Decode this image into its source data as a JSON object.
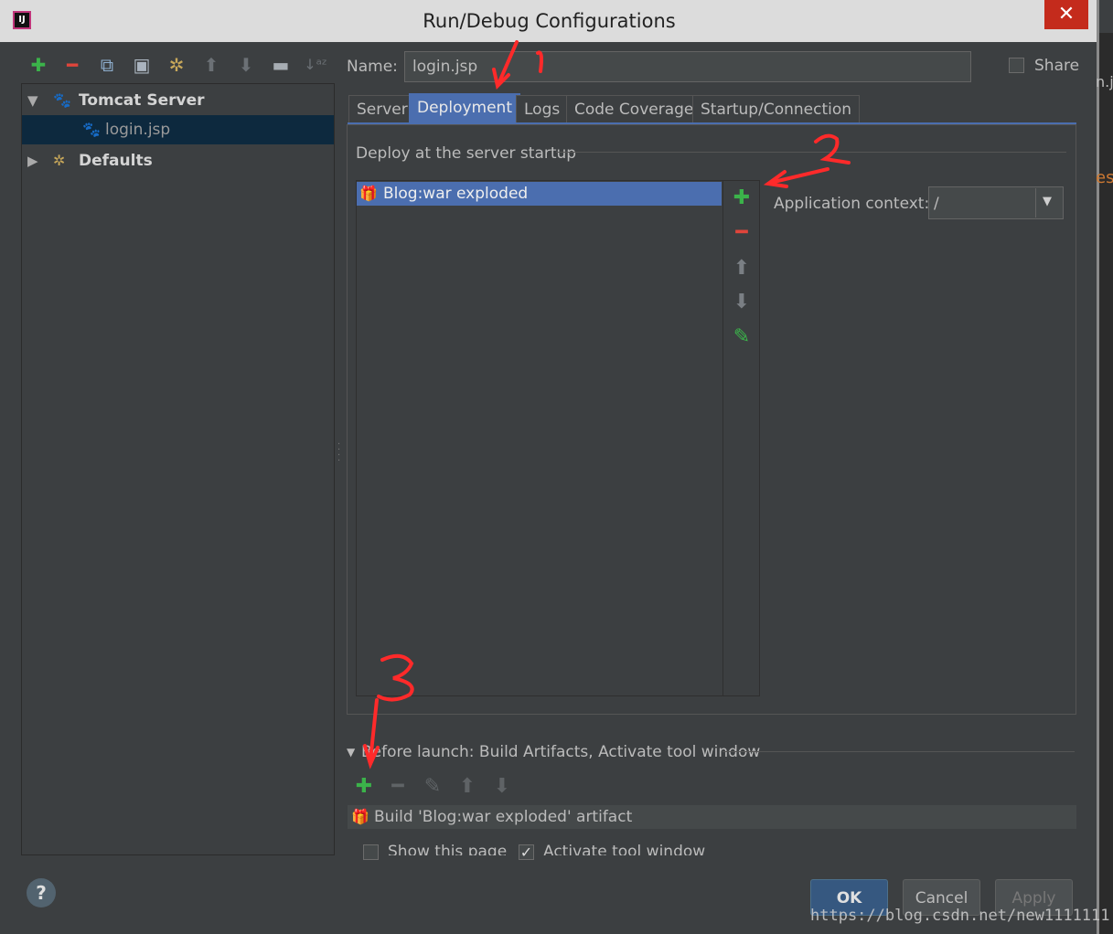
{
  "window": {
    "title": "Run/Debug Configurations",
    "app_icon_text": "IJ",
    "close_glyph": "✕"
  },
  "left_toolbar": {
    "icons": [
      "add-icon",
      "remove-icon",
      "copy-icon",
      "save-icon",
      "wrench-icon",
      "move-up-icon",
      "move-down-icon",
      "folder-icon",
      "sort-icon"
    ]
  },
  "tree": {
    "items": [
      {
        "label": "Tomcat Server",
        "expanded": true,
        "icon": "tomcat-icon"
      },
      {
        "label": "login.jsp",
        "selected": true,
        "icon": "tomcat-icon"
      },
      {
        "label": "Defaults",
        "expanded": false,
        "icon": "wrench-icon"
      }
    ]
  },
  "name_field": {
    "label": "Name:",
    "value": "login.jsp"
  },
  "share": {
    "label": "Share",
    "checked": false
  },
  "tabs": [
    {
      "label": "Server",
      "active": false
    },
    {
      "label": "Deployment",
      "active": true
    },
    {
      "label": "Logs",
      "active": false
    },
    {
      "label": "Code Coverage",
      "active": false
    },
    {
      "label": "Startup/Connection",
      "active": false
    }
  ],
  "deployment": {
    "section_title": "Deploy at the server startup",
    "artifacts": [
      {
        "label": "Blog:war exploded",
        "icon": "artifact-icon"
      }
    ],
    "application_context": {
      "label": "Application context:",
      "value": "/"
    }
  },
  "before_launch": {
    "title": "Before launch: Build Artifacts, Activate tool window",
    "items": [
      {
        "label": "Build 'Blog:war exploded' artifact",
        "icon": "artifact-icon"
      }
    ],
    "show_page": {
      "label": "Show this page",
      "checked": false
    },
    "activate_tool_window": {
      "label": "Activate tool window",
      "checked": true
    }
  },
  "buttons": {
    "help": "?",
    "ok": "OK",
    "cancel": "Cancel",
    "apply": "Apply"
  },
  "annotations": {
    "one": "1",
    "two": "2",
    "three": "3"
  },
  "watermark": "https://blog.csdn.net/new1111111",
  "editor_strip": {
    "fragment_top": "n.j",
    "fragment_mid": "es"
  },
  "colors": {
    "background": "#3c3f41",
    "accent": "#4b6eaf",
    "selection_dark": "#0d293e",
    "annotation_red": "#ff2a2a"
  }
}
